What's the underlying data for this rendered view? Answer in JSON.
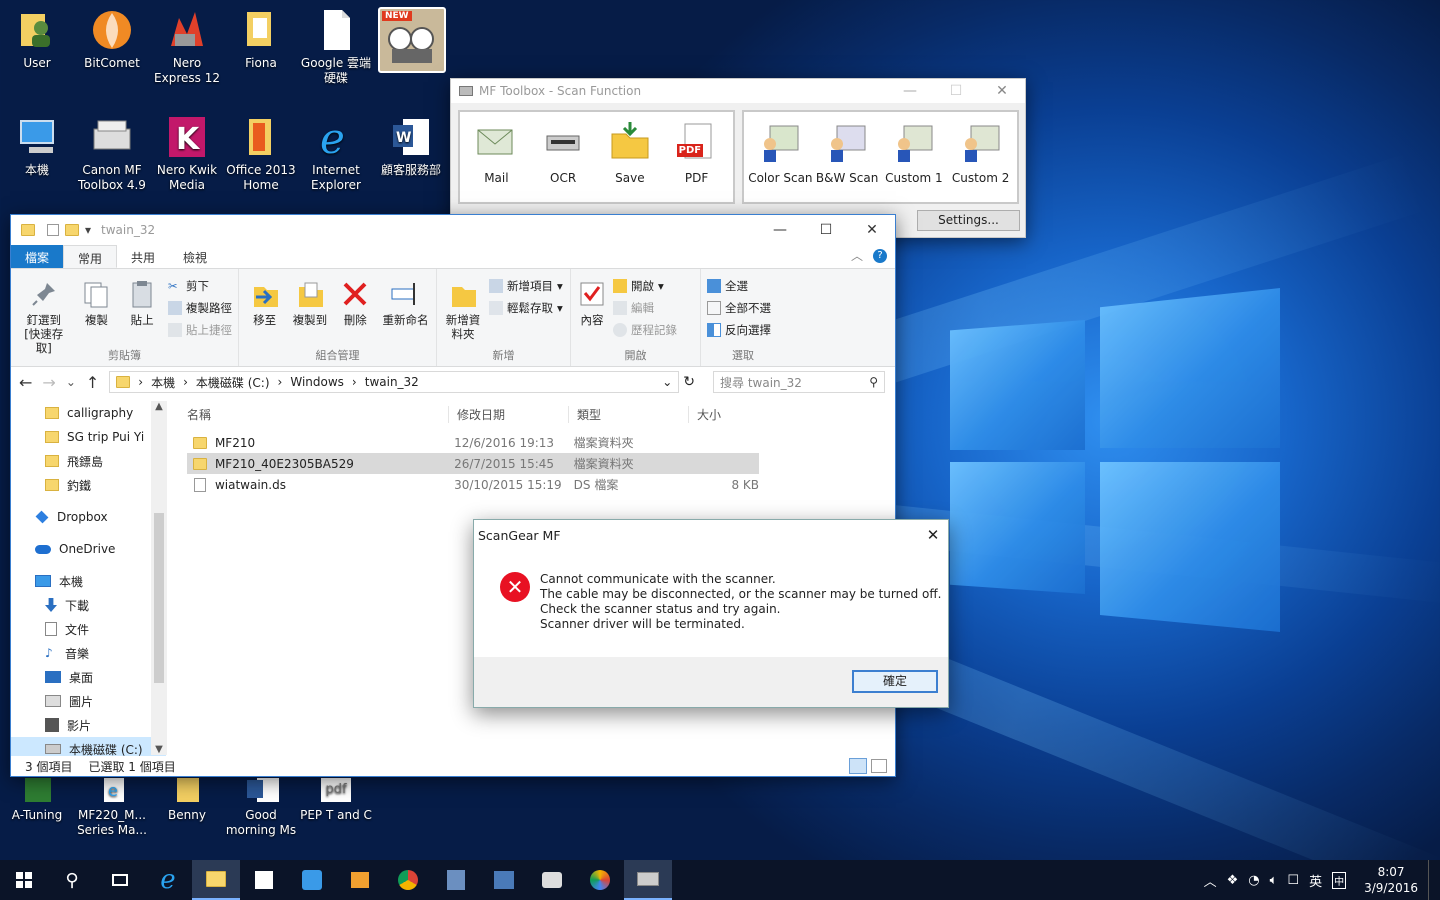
{
  "desktop": {
    "icons_top": [
      {
        "label": "User"
      },
      {
        "label": "BitComet"
      },
      {
        "label": "Nero Express 12"
      },
      {
        "label": "Fiona"
      },
      {
        "label": "Google 雲端硬碟"
      },
      {
        "label": "NEW"
      }
    ],
    "icons_row2": [
      {
        "label": "本機"
      },
      {
        "label": "Canon MF Toolbox 4.9"
      },
      {
        "label": "Nero Kwik Media"
      },
      {
        "label": "Office 2013 Home"
      },
      {
        "label": "Internet Explorer"
      },
      {
        "label": "顧客服務部"
      }
    ],
    "icons_bottom": [
      {
        "label": "A-Tuning"
      },
      {
        "label": "MF220_M... Series Ma..."
      },
      {
        "label": "Benny"
      },
      {
        "label": "Good morning Ms"
      },
      {
        "label": "PEP T and C"
      }
    ],
    "pdf_icon_text": "pdf"
  },
  "toolbox": {
    "title": "MF Toolbox - Scan Function",
    "left_buttons": [
      {
        "label": "Mail"
      },
      {
        "label": "OCR"
      },
      {
        "label": "Save"
      },
      {
        "label": "PDF"
      }
    ],
    "right_buttons": [
      {
        "label": "Color Scan"
      },
      {
        "label": "B&W Scan"
      },
      {
        "label": "Custom 1"
      },
      {
        "label": "Custom 2"
      }
    ],
    "settings_label": "Settings...",
    "pdf_badge": "PDF"
  },
  "explorer": {
    "title": "twain_32",
    "tabs": [
      "檔案",
      "常用",
      "共用",
      "檢視"
    ],
    "clipboard": {
      "pin": "釘選到 [快速存取]",
      "copy": "複製",
      "paste": "貼上",
      "cut": "剪下",
      "copy_path": "複製路徑",
      "paste_shortcut": "貼上捷徑",
      "group": "剪貼簿"
    },
    "organize": {
      "move": "移至",
      "copyto": "複製到",
      "delete": "刪除",
      "rename": "重新命名",
      "group": "組合管理"
    },
    "new": {
      "newfolder": "新增資料夾",
      "newitem": "新增項目",
      "easyaccess": "輕鬆存取",
      "group": "新增"
    },
    "open": {
      "properties": "內容",
      "open": "開啟",
      "edit": "編輯",
      "history": "歷程記錄",
      "group": "開啟"
    },
    "select": {
      "all": "全選",
      "none": "全部不選",
      "invert": "反向選擇",
      "group": "選取"
    },
    "path": [
      "本機",
      "本機磁碟 (C:)",
      "Windows",
      "twain_32"
    ],
    "search_placeholder": "搜尋 twain_32",
    "nav": [
      {
        "label": "calligraphy",
        "type": "folder"
      },
      {
        "label": "SG trip Pui Yi",
        "type": "folder"
      },
      {
        "label": "飛鏢島",
        "type": "folder"
      },
      {
        "label": "釣鐵",
        "type": "folder"
      },
      {
        "label": "Dropbox",
        "type": "dropbox"
      },
      {
        "label": "OneDrive",
        "type": "onedrive"
      },
      {
        "label": "本機",
        "type": "pc"
      },
      {
        "label": "下載",
        "type": "down"
      },
      {
        "label": "文件",
        "type": "doc"
      },
      {
        "label": "音樂",
        "type": "music"
      },
      {
        "label": "桌面",
        "type": "desk"
      },
      {
        "label": "圖片",
        "type": "pic"
      },
      {
        "label": "影片",
        "type": "video"
      },
      {
        "label": "本機磁碟 (C:)",
        "type": "drive"
      }
    ],
    "columns": [
      "名稱",
      "修改日期",
      "類型",
      "大小"
    ],
    "rows": [
      {
        "name": "MF210",
        "date": "12/6/2016 19:13",
        "type": "檔案資料夾",
        "size": ""
      },
      {
        "name": "MF210_40E2305BA529",
        "date": "26/7/2015 15:45",
        "type": "檔案資料夾",
        "size": ""
      },
      {
        "name": "wiatwain.ds",
        "date": "30/10/2015 15:19",
        "type": "DS 檔案",
        "size": "8 KB"
      }
    ],
    "status_count": "3 個項目",
    "status_selected": "已選取 1 個項目"
  },
  "dialog": {
    "title": "ScanGear MF",
    "lines": [
      "Cannot communicate with the scanner.",
      "The cable may be disconnected, or the scanner may be turned off.",
      "Check the scanner status and try again.",
      "Scanner driver will be terminated."
    ],
    "ok_label": "確定"
  },
  "taskbar": {
    "time": "8:07",
    "date": "3/9/2016",
    "ime": "英",
    "ime2": "中"
  },
  "colors": {
    "accent": "#1979ca",
    "desktop": "#0a3f93",
    "error": "#e81123"
  }
}
